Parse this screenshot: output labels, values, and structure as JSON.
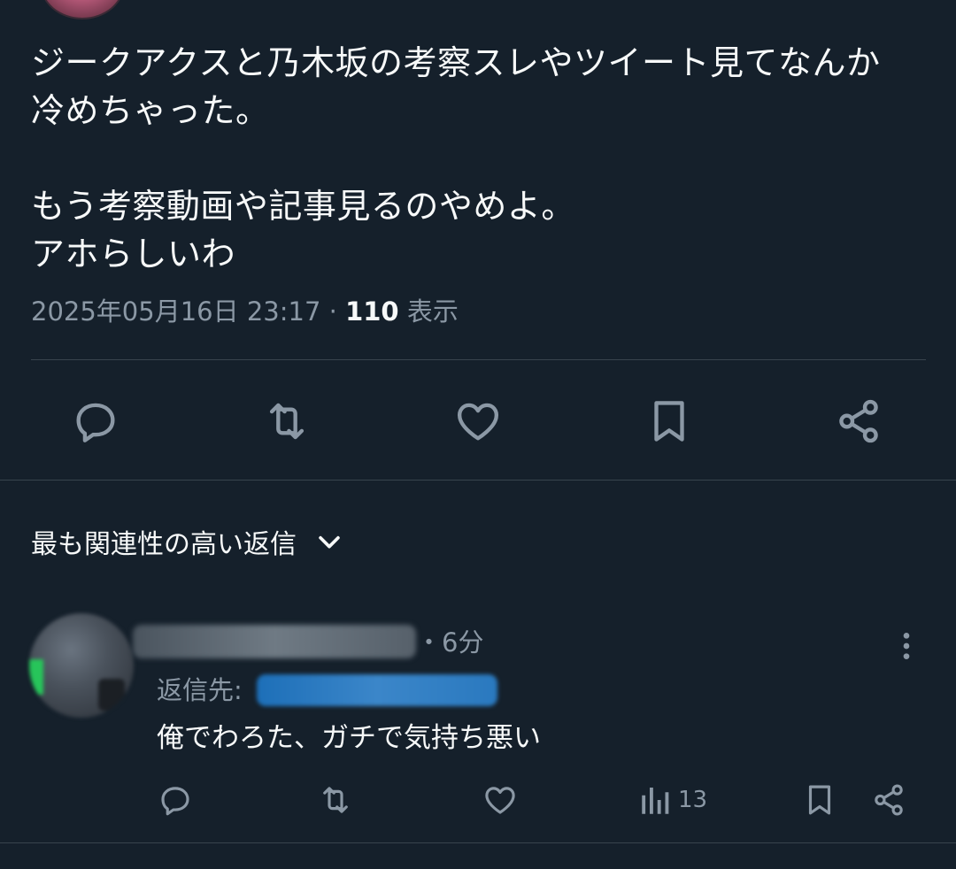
{
  "tweet": {
    "text_lines": [
      "ジークアクスと乃木坂の考察スレやツイート見てなんか",
      "冷めちゃった。",
      "",
      "もう考察動画や記事見るのやめよ。",
      "アホらしいわ"
    ],
    "timestamp": "2025年05月16日 23:17",
    "separator": " · ",
    "views_count": "110",
    "views_label": "表示"
  },
  "actions": {
    "reply_icon": "reply-icon",
    "retweet_icon": "retweet-icon",
    "like_icon": "heart-icon",
    "bookmark_icon": "bookmark-icon",
    "share_icon": "share-icon"
  },
  "replies_section": {
    "sort_label": "最も関連性の高い返信",
    "sort_icon": "chevron-down-icon"
  },
  "reply": {
    "time_partial": "・6分",
    "reply_to_label": "返信先:",
    "body": "俺でわろた、ガチで気持ち悪い",
    "views_count": "13"
  },
  "colors": {
    "background": "#15202b",
    "text": "#f7f9f9",
    "secondary": "#8b98a5",
    "divider": "#38444d",
    "link": "#1d9bf0"
  }
}
